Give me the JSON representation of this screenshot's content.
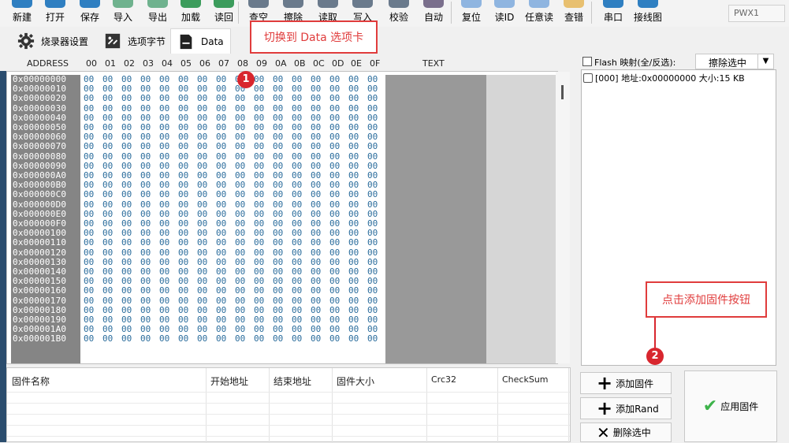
{
  "toolbar": {
    "buttons": [
      {
        "label": "新建",
        "icon": "new-file-icon",
        "color": "#2f7fc1"
      },
      {
        "label": "打开",
        "icon": "open-folder-icon",
        "color": "#2f7fc1"
      },
      {
        "label": "保存",
        "icon": "save-icon",
        "color": "#2f7fc1"
      },
      {
        "label": "导入",
        "icon": "import-icon",
        "color": "#6fb28e"
      },
      {
        "label": "导出",
        "icon": "export-icon",
        "color": "#6fb28e"
      },
      {
        "label": "加载",
        "icon": "load-icon",
        "color": "#3c9c5c"
      },
      {
        "label": "读回",
        "icon": "read-back-icon",
        "color": "#3c9c5c"
      },
      {
        "label": "查空",
        "icon": "blank-check-icon",
        "color": "#6a7a8c"
      },
      {
        "label": "擦除",
        "icon": "erase-icon",
        "color": "#6a7a8c"
      },
      {
        "label": "读取",
        "icon": "read-icon",
        "color": "#6a7a8c"
      },
      {
        "label": "写入",
        "icon": "write-icon",
        "color": "#6a7a8c"
      },
      {
        "label": "校验",
        "icon": "verify-icon",
        "color": "#6a7a8c"
      },
      {
        "label": "自动",
        "icon": "auto-icon",
        "color": "#7a6f8c"
      },
      {
        "label": "复位",
        "icon": "reset-icon",
        "color": "#8fb5e0"
      },
      {
        "label": "读ID",
        "icon": "read-id-icon",
        "color": "#8fb5e0"
      },
      {
        "label": "任意读",
        "icon": "any-read-icon",
        "color": "#8fb5e0"
      },
      {
        "label": "查错",
        "icon": "check-error-icon",
        "color": "#e8c070"
      },
      {
        "label": "串口",
        "icon": "serial-port-icon",
        "color": "#2f7fc1"
      },
      {
        "label": "接线图",
        "icon": "wiring-diagram-icon",
        "color": "#2f7fc1"
      }
    ],
    "device": "PWX1"
  },
  "tabs": [
    {
      "label": "烧录器设置",
      "icon": "gear-icon"
    },
    {
      "label": "选项字节",
      "icon": "option-bytes-icon"
    },
    {
      "label": "Data",
      "icon": "data-chip-icon"
    }
  ],
  "hex": {
    "header_address": "ADDRESS",
    "header_text": "TEXT",
    "columns": [
      "00",
      "01",
      "02",
      "03",
      "04",
      "05",
      "06",
      "07",
      "08",
      "09",
      "0A",
      "0B",
      "0C",
      "0D",
      "0E",
      "0F"
    ],
    "addresses": [
      "0x00000000",
      "0x00000010",
      "0x00000020",
      "0x00000030",
      "0x00000040",
      "0x00000050",
      "0x00000060",
      "0x00000070",
      "0x00000080",
      "0x00000090",
      "0x000000A0",
      "0x000000B0",
      "0x000000C0",
      "0x000000D0",
      "0x000000E0",
      "0x000000F0",
      "0x00000100",
      "0x00000110",
      "0x00000120",
      "0x00000130",
      "0x00000140",
      "0x00000150",
      "0x00000160",
      "0x00000170",
      "0x00000180",
      "0x00000190",
      "0x000001A0",
      "0x000001B0"
    ],
    "byte_value": "00"
  },
  "annotations": {
    "callout1": "切换到 Data 选项卡",
    "callout2": "点击添加固件按钮",
    "badge1": "1",
    "badge2": "2"
  },
  "flash": {
    "header_label": "Flash 映射(全/反选):",
    "erase_dropdown": "擦除选中",
    "items": [
      "[000] 地址:0x00000000 大小:15 KB"
    ]
  },
  "firmware_table": {
    "headers": [
      "固件名称",
      "开始地址",
      "结束地址",
      "固件大小",
      "Crc32",
      "CheckSum"
    ]
  },
  "buttons": {
    "add_firmware": "添加固件",
    "add_rand": "添加Rand",
    "delete_selected": "删除选中",
    "apply_firmware": "应用固件"
  }
}
